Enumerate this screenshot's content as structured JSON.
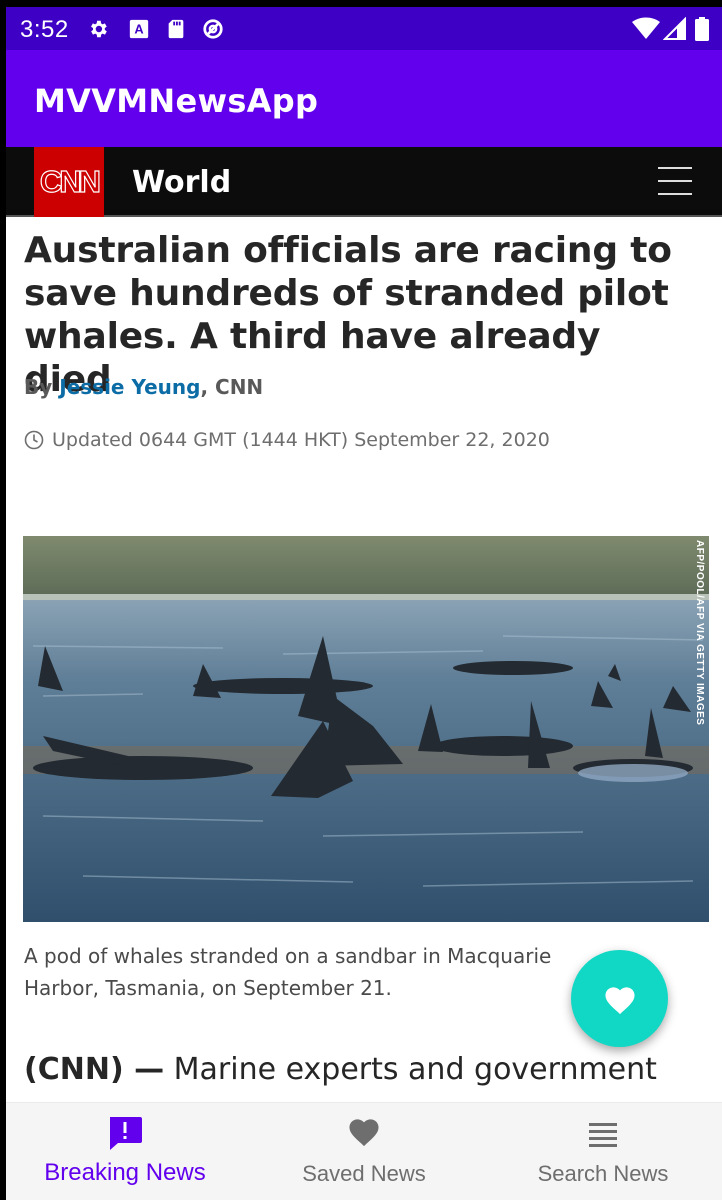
{
  "status_bar": {
    "time": "3:52",
    "left_icons": [
      "gear-icon",
      "a-badge-icon",
      "sd-card-icon",
      "data-saver-icon"
    ],
    "right_icons": [
      "wifi-icon",
      "signal-icon",
      "battery-icon"
    ]
  },
  "app_bar": {
    "title": "MVVMNewsApp",
    "color": "#6200ee"
  },
  "article": {
    "logo_text": "CNN",
    "section": "World",
    "headline": "Australian officials are racing to save hundreds of stranded pilot whales. A third have already died",
    "byline_prefix": "By ",
    "author": "Jessie Yeung",
    "byline_suffix": ", CNN",
    "updated": "Updated 0644 GMT (1444 HKT) September 22, 2020",
    "image_credit": "AFP/POOL/AFP VIA GETTY IMAGES",
    "caption": "A pod of whales stranded on a sandbar in Macquarie Harbor, Tasmania, on September 21.",
    "lead_source": "(CNN) —",
    "lead_text": "Marine experts and government"
  },
  "fab": {
    "icon": "heart-icon",
    "color": "#10d8c4"
  },
  "bottom_nav": {
    "items": [
      {
        "label": "Breaking News",
        "icon": "alert-icon",
        "active": true
      },
      {
        "label": "Saved News",
        "icon": "heart-icon",
        "active": false
      },
      {
        "label": "Search News",
        "icon": "list-icon",
        "active": false
      }
    ],
    "active_color": "#6200ee"
  }
}
